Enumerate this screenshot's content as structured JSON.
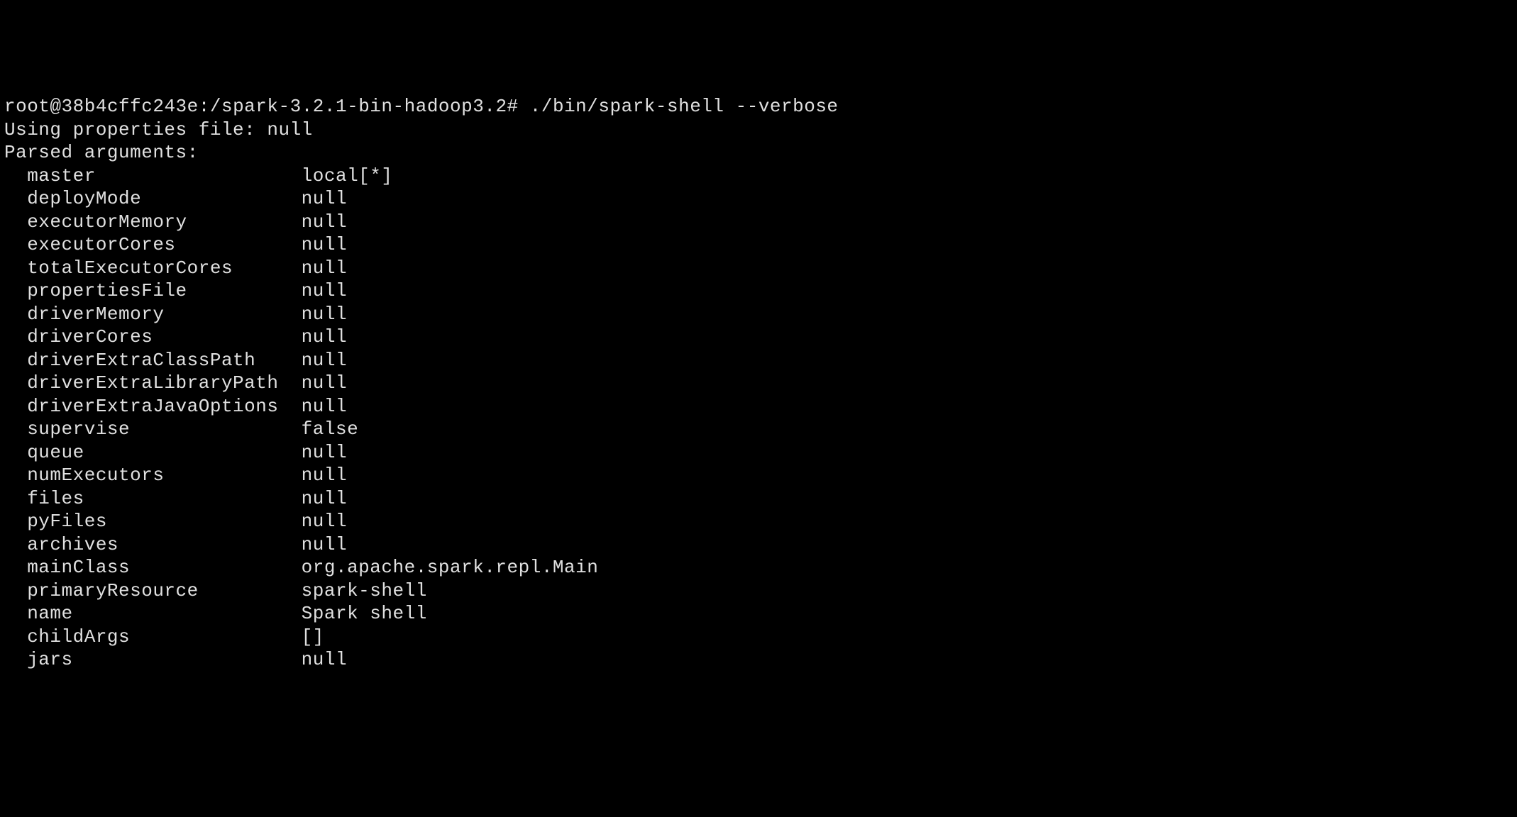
{
  "prompt": {
    "user": "root",
    "host": "38b4cffc243e",
    "path": "/spark-3.2.1-bin-hadoop3.2",
    "symbol": "#",
    "command": "./bin/spark-shell --verbose"
  },
  "output": {
    "propertiesFileLine": "Using properties file: null",
    "parsedArgumentsHeader": "Parsed arguments:",
    "arguments": [
      {
        "key": "master",
        "value": "local[*]"
      },
      {
        "key": "deployMode",
        "value": "null"
      },
      {
        "key": "executorMemory",
        "value": "null"
      },
      {
        "key": "executorCores",
        "value": "null"
      },
      {
        "key": "totalExecutorCores",
        "value": "null"
      },
      {
        "key": "propertiesFile",
        "value": "null"
      },
      {
        "key": "driverMemory",
        "value": "null"
      },
      {
        "key": "driverCores",
        "value": "null"
      },
      {
        "key": "driverExtraClassPath",
        "value": "null"
      },
      {
        "key": "driverExtraLibraryPath",
        "value": "null"
      },
      {
        "key": "driverExtraJavaOptions",
        "value": "null"
      },
      {
        "key": "supervise",
        "value": "false"
      },
      {
        "key": "queue",
        "value": "null"
      },
      {
        "key": "numExecutors",
        "value": "null"
      },
      {
        "key": "files",
        "value": "null"
      },
      {
        "key": "pyFiles",
        "value": "null"
      },
      {
        "key": "archives",
        "value": "null"
      },
      {
        "key": "mainClass",
        "value": "org.apache.spark.repl.Main"
      },
      {
        "key": "primaryResource",
        "value": "spark-shell"
      },
      {
        "key": "name",
        "value": "Spark shell"
      },
      {
        "key": "childArgs",
        "value": "[]"
      },
      {
        "key": "jars",
        "value": "null"
      }
    ]
  }
}
